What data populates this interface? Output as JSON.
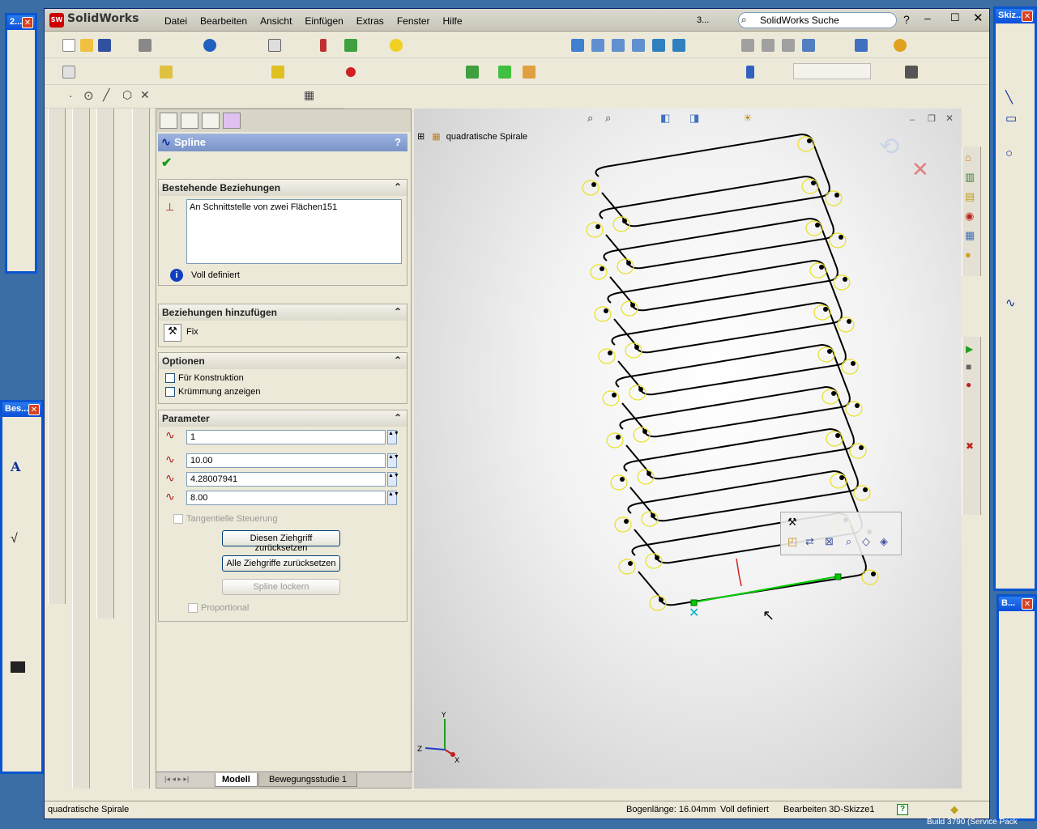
{
  "app": {
    "title": "SolidWorks",
    "search_placeholder": "SolidWorks Suche",
    "menu": [
      "Datei",
      "Bearbeiten",
      "Ansicht",
      "Einfügen",
      "Extras",
      "Fenster",
      "Hilfe"
    ],
    "tb_count": "3..."
  },
  "feature_tree": {
    "root": "quadratische Spirale"
  },
  "property_manager": {
    "title": "Spline",
    "help": "?",
    "existing_relations": {
      "header": "Bestehende Beziehungen",
      "items": [
        "An Schnittstelle von zwei Flächen151"
      ],
      "status": "Voll definiert"
    },
    "add_relations": {
      "header": "Beziehungen hinzufügen",
      "items": [
        "Fix"
      ]
    },
    "options": {
      "header": "Optionen",
      "for_construction": "Für Konstruktion",
      "show_curvature": "Krümmung anzeigen"
    },
    "parameters": {
      "header": "Parameter",
      "point": "1",
      "x": "10.00",
      "y": "4.28007941",
      "z": "8.00",
      "tangent_control": "Tangentielle Steuerung",
      "reset_handle": "Diesen Ziehgriff zurücksetzen",
      "reset_all": "Alle Ziehgriffe zurücksetzen",
      "relax": "Spline lockern",
      "proportional": "Proportional"
    }
  },
  "tabs": [
    "Modell",
    "Bewegungsstudie 1"
  ],
  "status": {
    "left": "quadratische Spirale",
    "arc_length": "Bogenlänge: 16.04mm",
    "defined": "Voll definiert",
    "editing": "Bearbeiten 3D-Skizze1"
  },
  "palettes": {
    "left_top": "2...",
    "left_mid": "Bes...",
    "right_top": "Skiz...",
    "right_bottom": "B..."
  },
  "desktop": {
    "build": "Build 3790 (Service Pack"
  },
  "axis": {
    "x": "X",
    "y": "Y",
    "z": "Z"
  },
  "colors": {
    "spline": "#00cc00",
    "geometry": "#000000",
    "handles": "#e8e020",
    "titlebar": "#0a4ed8"
  }
}
